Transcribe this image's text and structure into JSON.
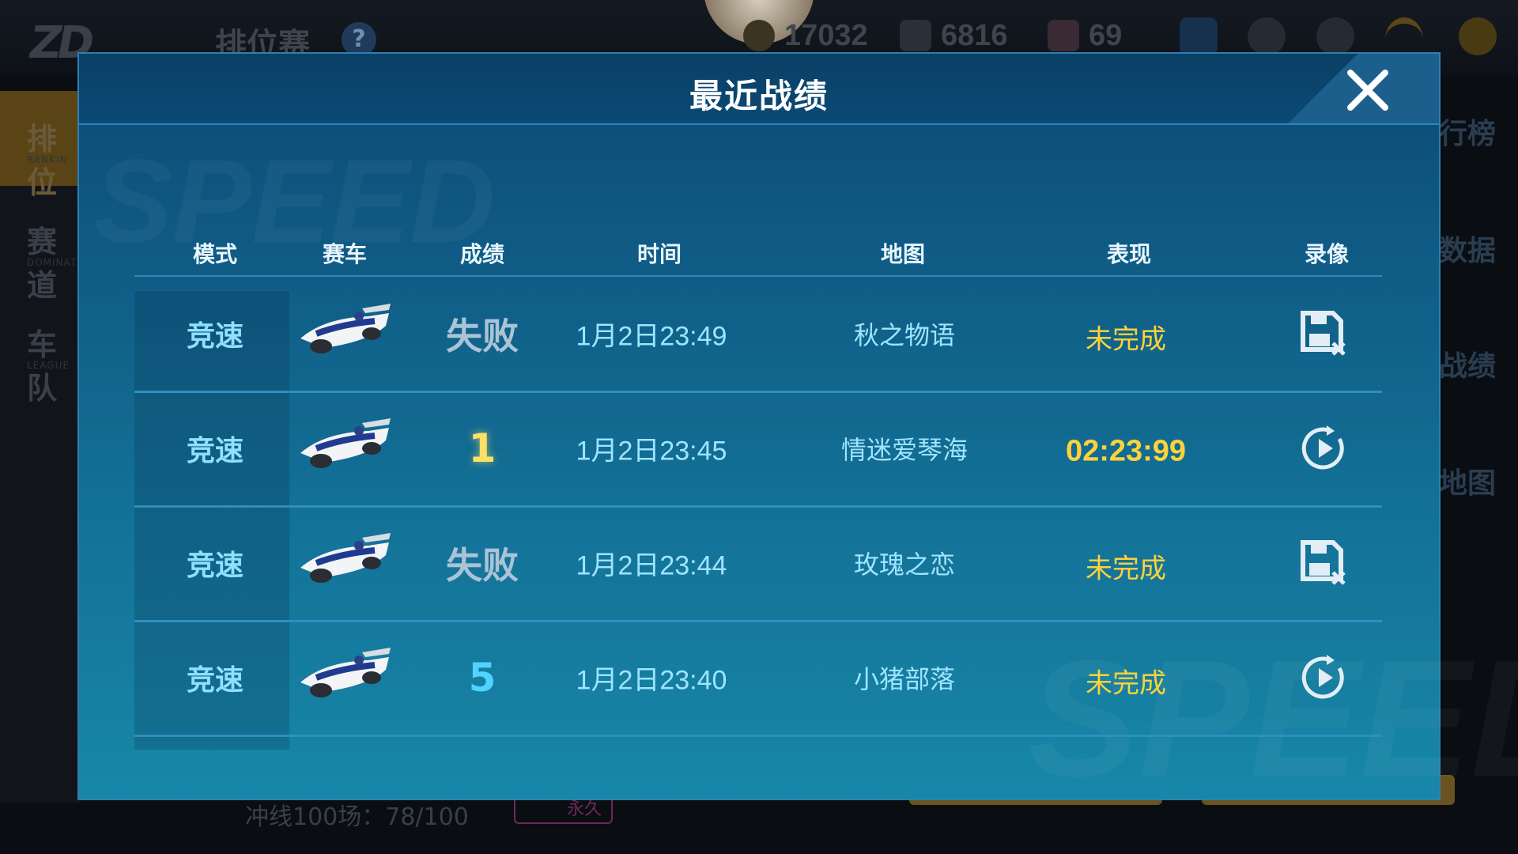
{
  "background": {
    "logo": "ZD",
    "title": "排位赛",
    "help": "?",
    "resources": [
      {
        "icon": "coin-icon",
        "value": "17032"
      },
      {
        "icon": "diamond-icon",
        "value": "6816"
      },
      {
        "icon": "gem-icon",
        "value": "69"
      }
    ],
    "nav": [
      {
        "label": "排位",
        "sub": "RANKIN"
      },
      {
        "label": "赛道",
        "sub": "DOMINAT"
      },
      {
        "label": "车队",
        "sub": "LEAGUE"
      }
    ],
    "right_items": [
      "行榜",
      "数据",
      "战绩",
      "地图"
    ],
    "progress_text": "冲线100场：78/100",
    "badge": "永久"
  },
  "modal": {
    "title": "最近战绩",
    "columns": [
      "模式",
      "赛车",
      "成绩",
      "时间",
      "地图",
      "表现",
      "录像"
    ],
    "rows": [
      {
        "mode": "竞速",
        "result": "失败",
        "time": "1月2日23:49",
        "map": "秋之物语",
        "performance": "未完成",
        "replay": "replay-unavailable-icon"
      },
      {
        "mode": "竞速",
        "result": "1",
        "time": "1月2日23:45",
        "map": "情迷爱琴海",
        "performance": "02:23:99",
        "replay": "replay-play-icon"
      },
      {
        "mode": "竞速",
        "result": "失败",
        "time": "1月2日23:44",
        "map": "玫瑰之恋",
        "performance": "未完成",
        "replay": "replay-unavailable-icon"
      },
      {
        "mode": "竞速",
        "result": "5",
        "time": "1月2日23:40",
        "map": "小猪部落",
        "performance": "未完成",
        "replay": "replay-play-icon"
      }
    ]
  },
  "colors": {
    "accent": "#8fe0ff",
    "gold": "#ffd23a",
    "panel_top": "#0c4a73",
    "panel_bottom": "#1787a8"
  }
}
